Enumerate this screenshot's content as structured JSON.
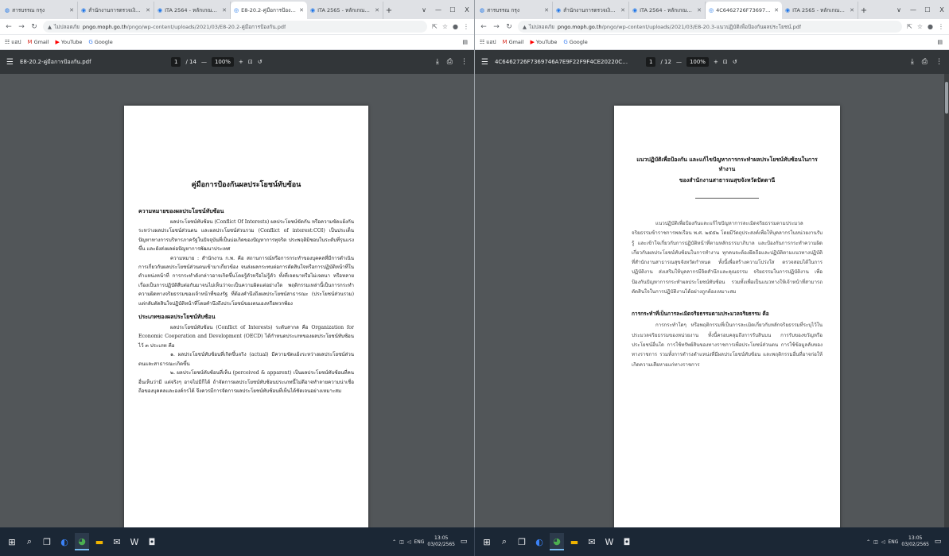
{
  "left_window": {
    "tabs": [
      {
        "label": "สารบรรณ กรุง",
        "active": false
      },
      {
        "label": "สำนักงานการตรวจเงินแผ่นดิน",
        "active": false
      },
      {
        "label": "ITA 2564 - หลักเกณฑ์การประเมิน",
        "active": false
      },
      {
        "label": "E8-20.2-คู่มือการป้องกัน.pdf",
        "active": true
      },
      {
        "label": "ITA 2565 - หลักเกณฑ์การประเมิน",
        "active": false
      }
    ],
    "new_tab": "+",
    "window_controls": {
      "dropdown": "∨",
      "minimize": "—",
      "maximize": "☐",
      "close": "X"
    },
    "url": {
      "security": "ไม่ปลอดภัย",
      "host": "pngo.moph.go.th",
      "path": "/pngo/wp-content/uploads/2021/03/E8-20.2-คู่มือการป้องกัน.pdf"
    },
    "bookmarks": [
      {
        "icon": "apps-icon",
        "label": "แอป"
      },
      {
        "icon": "gmail-icon",
        "label": "Gmail"
      },
      {
        "icon": "youtube-icon",
        "label": "YouTube"
      },
      {
        "icon": "google-icon",
        "label": "Google"
      }
    ],
    "bookmarks_other": "",
    "pdf": {
      "file": "E8-20.2-คู่มือการป้องกัน.pdf",
      "page": "1",
      "total": "/ 14",
      "zoom": "100%",
      "zoom_out": "—",
      "zoom_in": "+"
    },
    "doc": {
      "title": "คู่มือการป้องกันผลประโยชน์ทับซ้อน",
      "s1_heading": "ความหมายของผลประโยชน์ทับซ้อน",
      "s1_p1": "ผลประโยชน์ทับซ้อน (Conflict Of Interests) ผลประโยชน์ขัดกัน หรือความขัดแย้งกันระหว่างผลประโยชน์ส่วนตน และผลประโยชน์ส่วนรวม (Conflict of interest:COI) เป็นประเด็นปัญหาทางการบริหารภาครัฐในปัจจุบันที่เป็นบ่อเกิดของปัญหาการทุจริต ประพฤติมิชอบในระดับที่รุนแรงขึ้น และยังส่งผลต่อปัญหาการพัฒนาประเทศ",
      "s1_p2": "ความหมาย : สำนักงาน ก.พ. คือ สถานการณ์หรือการกระทำของบุคคลที่มีการดำเนินการเกี่ยวกับผลประโยชน์ส่วนตนเข้ามาเกี่ยวข้อง จนส่งผลกระทบต่อการตัดสินใจหรือการปฏิบัติหน้าที่ในตำแหน่งหน้าที่ การกระทำดังกล่าวอาจเกิดขึ้นโดยรู้ตัวหรือไม่รู้ตัว ทั้งที่เจตนาหรือไม่เจตนา หรือหลายเรื่องเป็นการปฏิบัติสืบต่อกันมาจนไม่เห็นว่าจะเป็นความผิดแต่อย่างใด พฤติกรรมเหล่านี้เป็นการกระทำความผิดทางจริยธรรมของเจ้าหน้าที่ของรัฐ ที่ต้องคำนึงถึงผลประโยชน์สาธารณะ (ประโยชน์ส่วนรวม) แต่กลับตัดสินใจปฏิบัติหน้าที่โดยคำนึงถึงประโยชน์ของตนเองหรือพวกพ้อง",
      "s2_heading": "ประเภทของผลประโยชน์ทับซ้อน",
      "s2_p1": "ผลประโยชน์ทับซ้อน (Conflict of Interests) ระดับสากล คือ Organization for Economic Cooperation and Development (OECD) ได้กำหนดประเภทของผลประโยชน์ทับซ้อน ไว้ ๓ ประเภท คือ",
      "s2_p2": "๑. ผลประโยชน์ทับซ้อนที่เกิดขึ้นจริง (actual) มีความขัดแย้งระหว่างผลประโยชน์ส่วนตนและสาธารณะเกิดขึ้น",
      "s2_p3": "๒. ผลประโยชน์ทับซ้อนที่เห็น (perceived & apparent) เป็นผลประโยชน์ทับซ้อนที่คนอื่นเห็นว่ามี แต่จริงๆ อาจไม่มีก็ได้ ถ้าจัดการผลประโยชน์ทับซ้อนประเภทนี้ไม่ดีอาจทำลายความน่าเชื่อถือของบุคคลและองค์กรได้ จึงควรมีการจัดการผลประโยชน์ทับซ้อนที่เห็นได้ชัดเจนอย่างเหมาะสม"
    }
  },
  "right_window": {
    "tabs": [
      {
        "label": "สารบรรณ กรุง",
        "active": false
      },
      {
        "label": "สำนักงานการตรวจเงินแผ่นดิน",
        "active": false
      },
      {
        "label": "ITA 2564 - หลักเกณฑ์การประเมิน",
        "active": false
      },
      {
        "label": "4C6462726F7369746A7E9F22F",
        "active": true
      },
      {
        "label": "ITA 2565 - หลักเกณฑ์การประเมิน",
        "active": false
      }
    ],
    "new_tab": "+",
    "window_controls": {
      "dropdown": "∨",
      "minimize": "—",
      "maximize": "☐",
      "close": "X"
    },
    "url": {
      "security": "ไม่ปลอดภัย",
      "host": "pngo.moph.go.th",
      "path": "/pngo/wp-content/uploads/2021/03/E8-20.3-แนวปฏิบัติเพื่อป้องกันผลประโยชน์.pdf"
    },
    "bookmarks": [
      {
        "icon": "apps-icon",
        "label": "แอป"
      },
      {
        "icon": "gmail-icon",
        "label": "Gmail"
      },
      {
        "icon": "youtube-icon",
        "label": "YouTube"
      },
      {
        "icon": "google-icon",
        "label": "Google"
      }
    ],
    "bookmarks_other": "",
    "pdf": {
      "file": "4C6462726F7369746A7E9F22F9F4CE20220C2E8B3BC79B8AF649AF8803A0DC67...",
      "page": "1",
      "total": "/ 12",
      "zoom": "100%",
      "zoom_out": "—",
      "zoom_in": "+"
    },
    "doc": {
      "title_line1": "แนวปฏิบัติเพื่อป้องกัน และแก้ไขปัญหาการกระทำผลประโยชน์ทับซ้อนในการทำงาน",
      "title_line2": "ของสำนักงานสาธารณสุขจังหวัดปัตตานี",
      "p1": "แนวปฏิบัติเพื่อป้องกันและแก้ไขปัญหาการละเมิดจริยธรรมตามประมวลจริยธรรมข้าราชการพลเรือน พ.ศ. ๒๕๕๒ โดยมีวัตถุประสงค์เพื่อให้บุคลากรในหน่วยงานรับรู้ และเข้าใจเกี่ยวกับการปฏิบัติหน้าที่ตามหลักธรรมาภิบาล และป้องกันการกระทำความผิดเกี่ยวกับผลประโยชน์ทับซ้อนในการทำงาน ทุกคนจะต้องยึดถือและปฏิบัติตามแนวทางปฏิบัติที่สำนักงานสาธารณสุขจังหวัดกำหนด ทั้งนี้เพื่อสร้างความโปร่งใส ตรวจสอบได้ในการปฏิบัติงาน ส่งเสริมให้บุคลากรมีจิตสำนึกและคุณธรรม จริยธรรมในการปฏิบัติงาน เพื่อป้องกันปัญหาการกระทำผลประโยชน์ทับซ้อน รวมทั้งเพื่อเป็นแนวทางให้เจ้าหน้าที่สามารถตัดสินใจในการปฏิบัติงานได้อย่างถูกต้องเหมาะสม",
      "h2": "การกระทำที่เป็นการละเมิดจริยธรรมตามประมวลจริยธรรม คือ",
      "p2": "การกระทำใดๆ หรือพฤติกรรมที่เป็นการละเมิดเกี่ยวกับหลักจริยธรรมที่ระบุไว้ในประมวลจริยธรรมของหน่วยงาน ทั้งนี้ครอบคลุมถึงการรับสินบน การรับของขวัญหรือประโยชน์อื่นใด การใช้ทรัพย์สินของทางราชการเพื่อประโยชน์ส่วนตน การใช้ข้อมูลลับของทางราชการ รวมทั้งการดำรงตำแหน่งที่มีผลประโยชน์ทับซ้อน และพฤติกรรมอื่นที่อาจก่อให้เกิดความเสียหายแก่ทางราชการ"
    }
  },
  "taskbar": {
    "left": {
      "clock_time": "13:05",
      "clock_date": "03/02/2565",
      "lang": "ENG"
    },
    "right": {
      "clock_time": "13:05",
      "clock_date": "03/02/2565",
      "lang": "ENG"
    }
  },
  "colors": {
    "tabstrip": "#dfe1e5",
    "pdf_toolbar": "#323639",
    "pdf_viewer": "#525659",
    "taskbar": "#1b2735"
  }
}
